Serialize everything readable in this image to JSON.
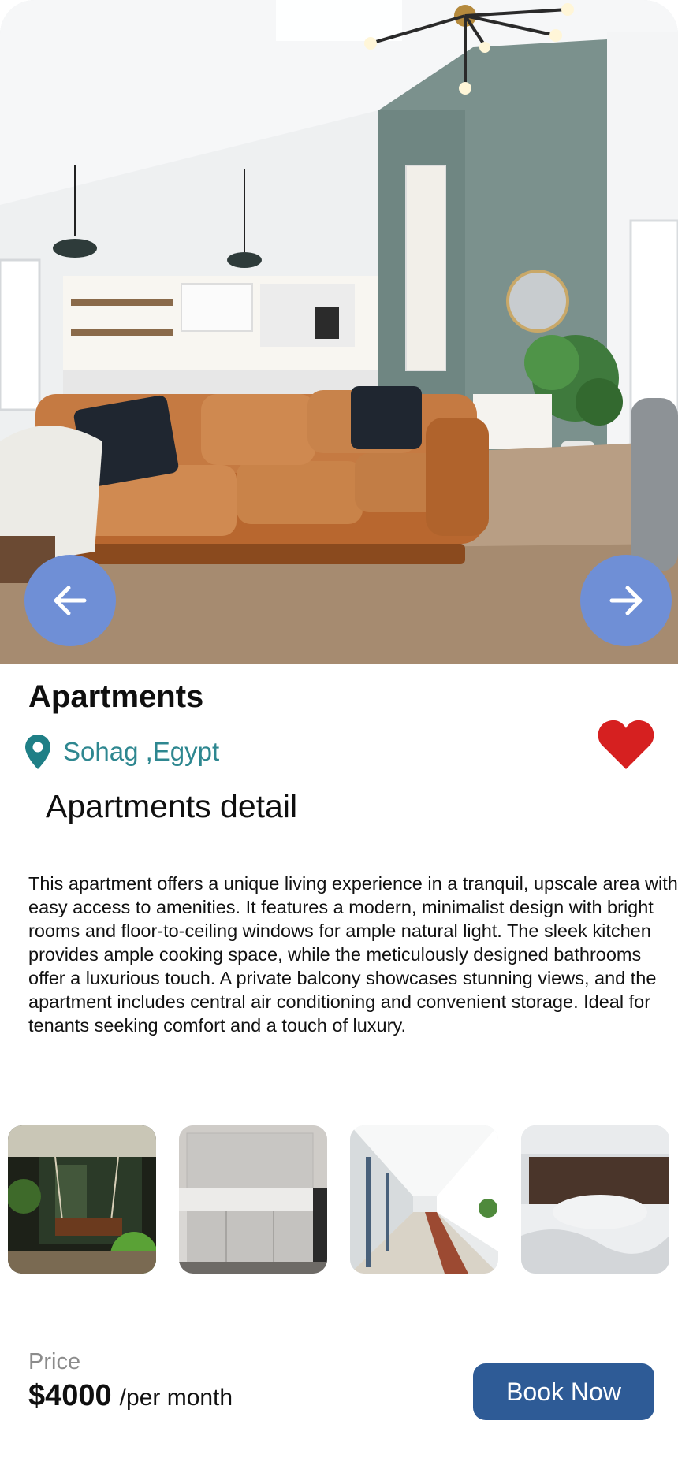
{
  "hero": {
    "image_desc": "living room with leather sofa",
    "prev_icon": "arrow-left-icon",
    "next_icon": "arrow-right-icon",
    "nav_button_color": "#6f8fd6"
  },
  "listing": {
    "title": "Apartments",
    "location": "Sohag ,Egypt",
    "location_icon": "map-pin-icon",
    "favorite_icon": "heart-icon",
    "favorite_color": "#d62020",
    "accent_color": "#2e8790"
  },
  "details": {
    "heading": "Apartments detail",
    "description": "This apartment offers a unique living experience in a tranquil, upscale area with easy access to amenities. It features a modern, minimalist design with bright rooms and floor-to-ceiling windows for ample natural light. The sleek kitchen provides ample cooking space, while the meticulously designed bathrooms offer a luxurious touch. A private balcony showcases stunning views, and the apartment includes central air conditioning and convenient storage. Ideal for tenants seeking comfort and a touch of luxury."
  },
  "gallery": [
    "porch swing",
    "kitchen",
    "corridor",
    "bedroom"
  ],
  "pricing": {
    "label": "Price",
    "amount": "$4000",
    "unit": "/per month"
  },
  "book_button": {
    "label": "Book Now",
    "color": "#2e5b96"
  }
}
